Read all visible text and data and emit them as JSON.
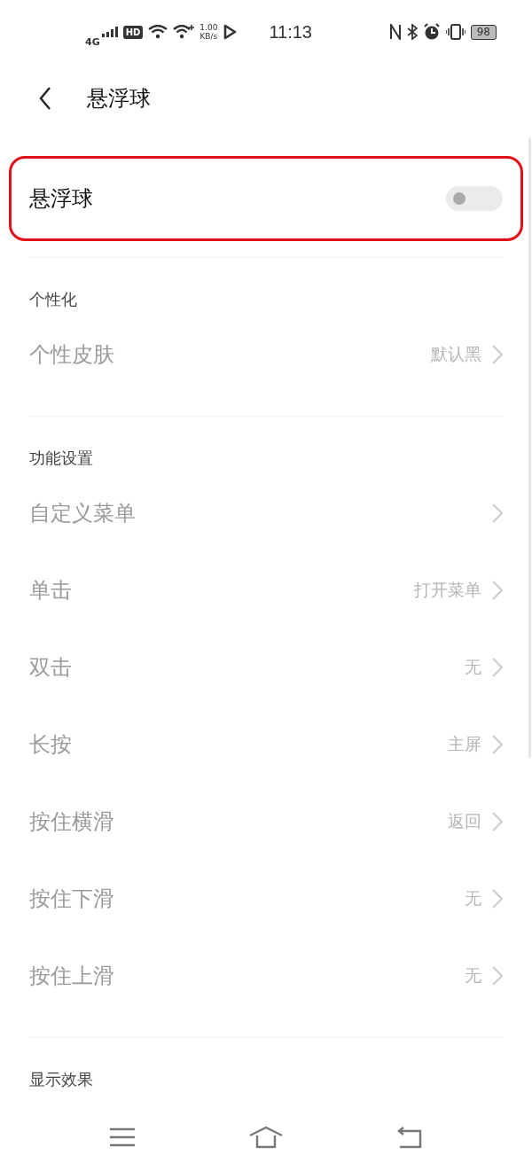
{
  "status_bar": {
    "network": "4G",
    "hd": "HD",
    "speed_value": "1.00",
    "speed_unit": "KB/s",
    "time": "11:13",
    "battery": "98"
  },
  "header": {
    "title": "悬浮球"
  },
  "master_switch": {
    "label": "悬浮球",
    "on": false,
    "highlighted": true
  },
  "sections": [
    {
      "title": "个性化",
      "items": [
        {
          "label": "个性皮肤",
          "value": "默认黑",
          "disabled": true
        }
      ]
    },
    {
      "title": "功能设置",
      "items": [
        {
          "label": "自定义菜单",
          "disabled": true
        },
        {
          "label": "单击",
          "value": "打开菜单",
          "disabled": true
        },
        {
          "label": "双击",
          "value": "无",
          "disabled": true
        },
        {
          "label": "长按",
          "value": "主屏",
          "disabled": true
        },
        {
          "label": "按住横滑",
          "value": "返回",
          "disabled": true
        },
        {
          "label": "按住下滑",
          "value": "无",
          "disabled": true
        },
        {
          "label": "按住上滑",
          "value": "无",
          "disabled": true
        }
      ]
    },
    {
      "title": "显示效果"
    }
  ]
}
